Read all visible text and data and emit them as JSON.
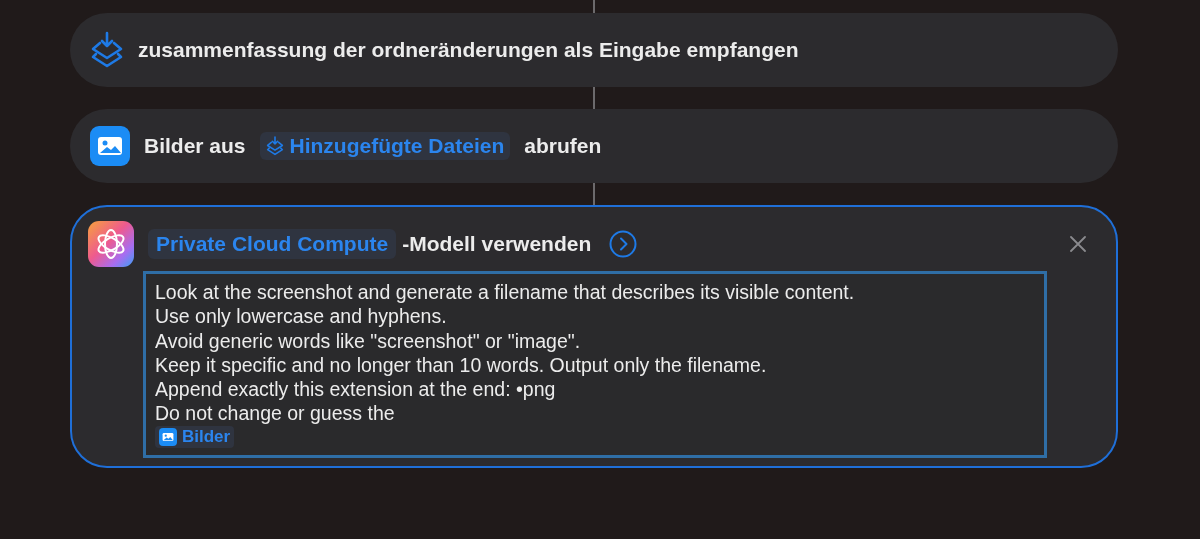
{
  "receive_action": {
    "selected": false,
    "text": "zusammenfassung der ordneränderungen als Eingabe empfangen"
  },
  "get_images_action": {
    "selected": false,
    "prefix": "Bilder aus",
    "variable": "Hinzugefügte Dateien",
    "suffix": "abrufen"
  },
  "model_action": {
    "selected": true,
    "model": "Private Cloud Compute",
    "suffix": "-Modell verwenden",
    "prompt_lines": [
      "Look at the screenshot and generate a filename that describes its visible content.",
      "Use only lowercase and hyphens.",
      "Avoid generic words like \"screenshot\" or \"image\".",
      "Keep it specific and no longer than 10 words. Output only the filename.",
      "Append exactly this extension at the end: •png",
      "Do not change or guess the"
    ],
    "prompt_variable": "Bilder"
  }
}
